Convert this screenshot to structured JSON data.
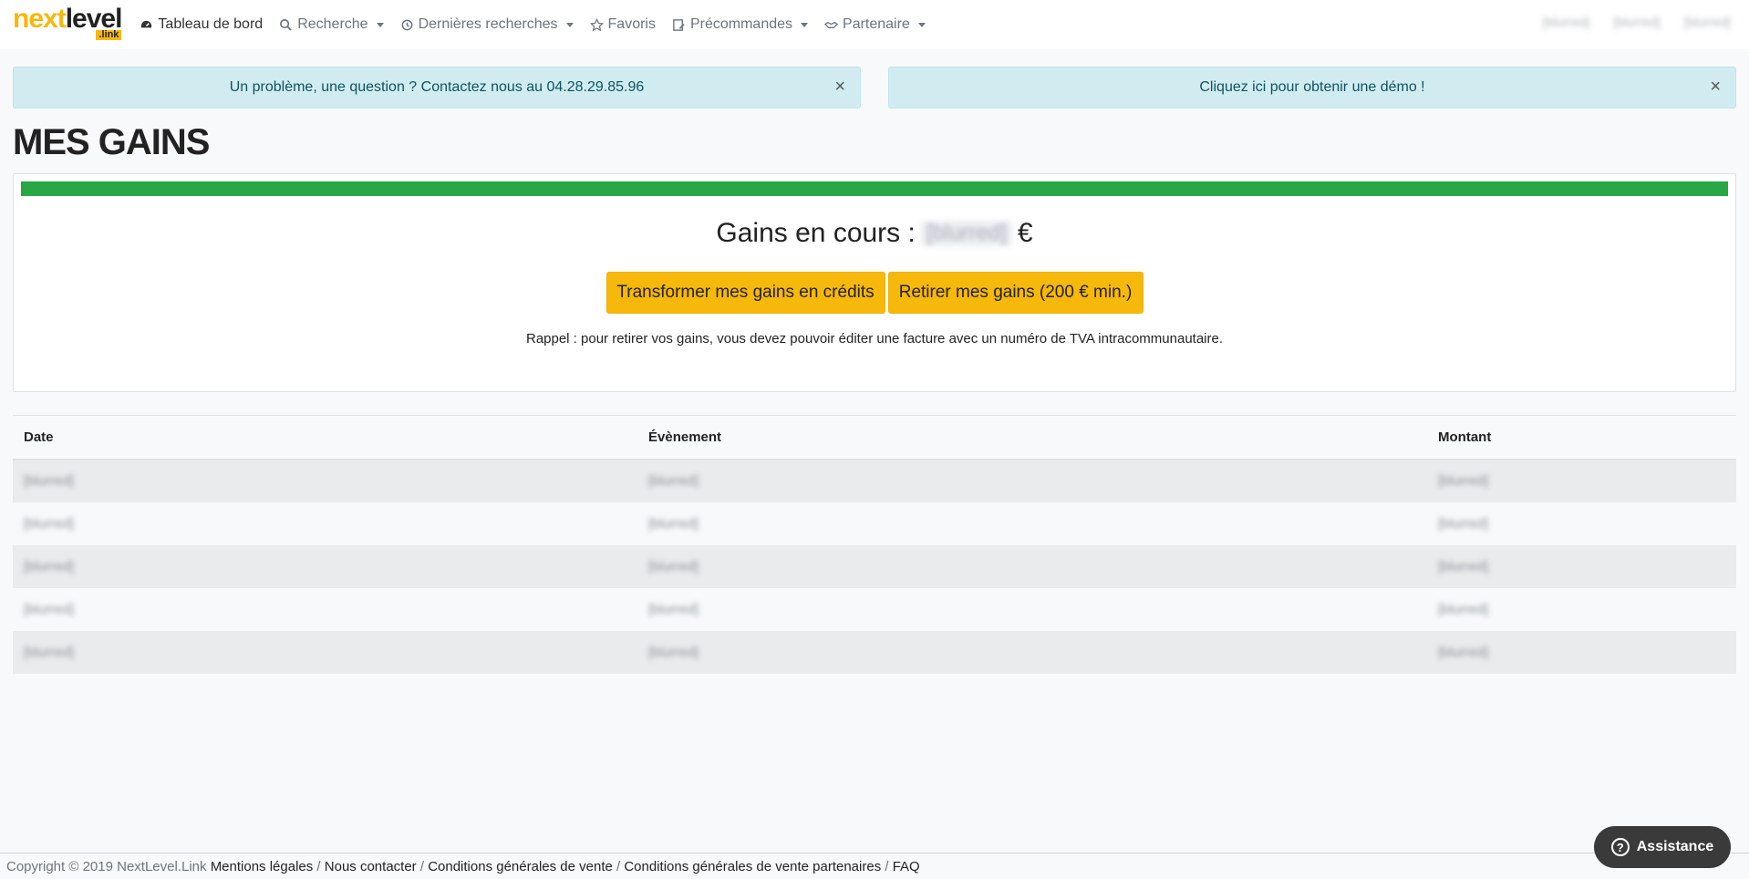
{
  "brand": {
    "name_part1": "next",
    "name_part2": "level",
    "sub": ".link"
  },
  "nav": {
    "items": [
      {
        "label": "Tableau de bord",
        "icon": "dashboard-icon",
        "dropdown": false
      },
      {
        "label": "Recherche",
        "icon": "search-icon",
        "dropdown": true
      },
      {
        "label": "Dernières recherches",
        "icon": "history-icon",
        "dropdown": true
      },
      {
        "label": "Favoris",
        "icon": "star-icon",
        "dropdown": false
      },
      {
        "label": "Précommandes",
        "icon": "preorder-icon",
        "dropdown": true
      },
      {
        "label": "Partenaire",
        "icon": "handshake-icon",
        "dropdown": true
      }
    ],
    "user": "[blurred]",
    "credit": "[blurred]",
    "gains": "[blurred]"
  },
  "alerts": {
    "left": {
      "text": "Un problème, une question ? Contactez nous au 04.28.29.85.96",
      "close": "×"
    },
    "right": {
      "text": "Cliquez ici pour obtenir une démo !",
      "close": "×"
    }
  },
  "page": {
    "title": "MES GAINS"
  },
  "card": {
    "progress_percent": 100,
    "gains_label": "Gains en cours :",
    "gains_value": "[blurred]",
    "currency": "€",
    "btn_transform": "Transformer mes gains en crédits",
    "btn_withdraw": "Retirer mes gains (200 € min.)",
    "reminder": "Rappel : pour retirer vos gains, vous devez pouvoir éditer une facture avec un numéro de TVA intracommunautaire."
  },
  "table": {
    "headers": {
      "date": "Date",
      "event": "Évènement",
      "amount": "Montant"
    },
    "rows": [
      {
        "date": "[blurred]",
        "event": "[blurred]",
        "amount": "[blurred]"
      },
      {
        "date": "[blurred]",
        "event": "[blurred]",
        "amount": "[blurred]"
      },
      {
        "date": "[blurred]",
        "event": "[blurred]",
        "amount": "[blurred]"
      },
      {
        "date": "[blurred]",
        "event": "[blurred]",
        "amount": "[blurred]"
      },
      {
        "date": "[blurred]",
        "event": "[blurred]",
        "amount": "[blurred]"
      }
    ]
  },
  "footer": {
    "copyright": "Copyright © 2019 NextLevel.Link",
    "links": [
      "Mentions légales",
      "Nous contacter",
      "Conditions générales de vente",
      "Conditions générales de vente partenaires",
      "FAQ"
    ],
    "separator": " / "
  },
  "assistance": {
    "label": "Assistance",
    "icon_glyph": "?"
  },
  "colors": {
    "accent": "#f6b80a",
    "progress": "#28a745",
    "alert_bg": "#d1ecf1",
    "alert_text": "#0c5460"
  }
}
